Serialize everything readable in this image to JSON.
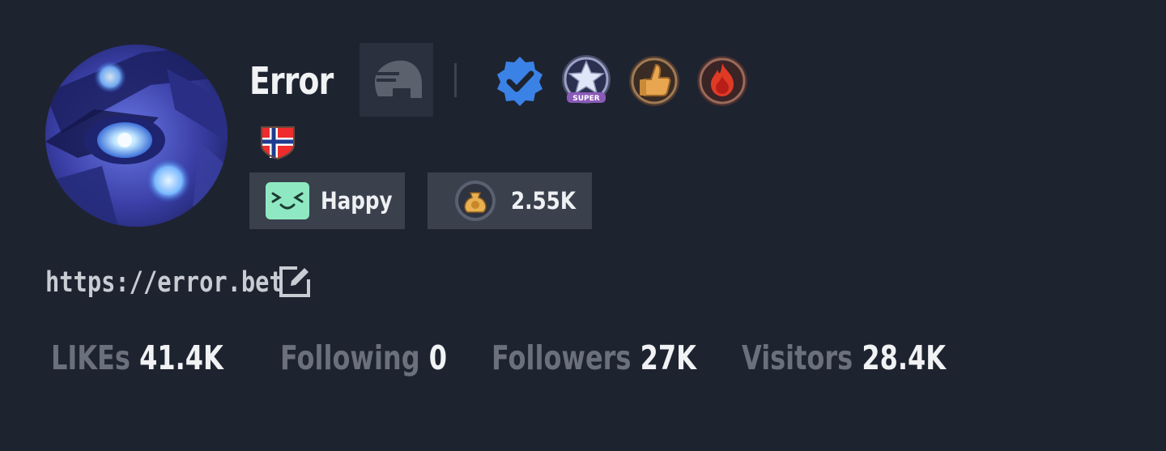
{
  "profile": {
    "name": "Error",
    "mood": "Happy",
    "coins": "2.55K",
    "link": "https://error.bet"
  },
  "badges": {
    "guild": "guild-helmet-icon",
    "verified": "verified-badge-icon",
    "super": "SUPER",
    "like": "thumbs-up-badge-icon",
    "fire": "fire-badge-icon",
    "flag": "norway-flag-icon"
  },
  "stats": [
    {
      "label": "LIKEs",
      "value": "41.4K"
    },
    {
      "label": "Following",
      "value": "0"
    },
    {
      "label": "Followers",
      "value": "27K"
    },
    {
      "label": "Visitors",
      "value": "28.4K"
    }
  ],
  "colors": {
    "background": "#1e2330",
    "chip": "#3a414d",
    "label": "#6b717c",
    "text": "#f1f2f4",
    "verified": "#3b82e6",
    "mood": "#8ee9c2"
  }
}
